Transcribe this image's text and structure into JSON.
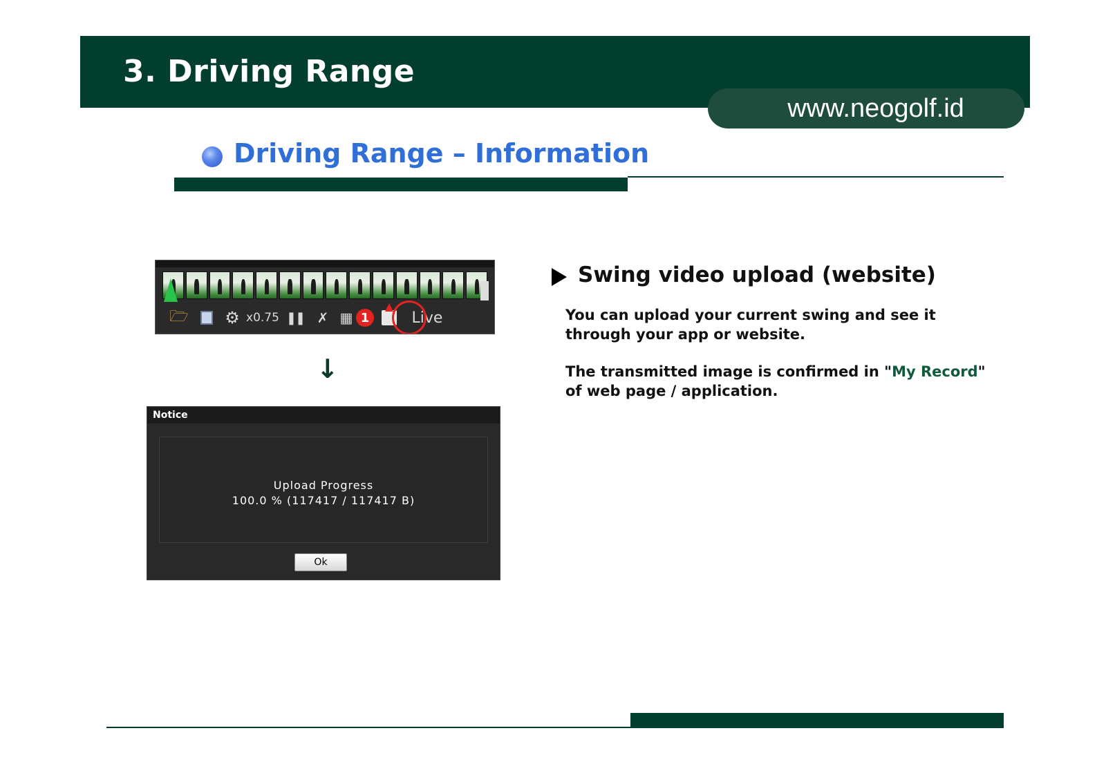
{
  "header": {
    "title": "3. Driving Range",
    "url": "www.neogolf.id"
  },
  "section": {
    "title": "Driving Range – Information"
  },
  "toolbar": {
    "speed_label": "x0.75",
    "live_label": "Live",
    "step_badge": "1",
    "icons": [
      "folder-icon",
      "save-icon",
      "gear-icon",
      "pause-icon",
      "club-icon",
      "grid-icon",
      "upload-icon"
    ]
  },
  "dialog": {
    "title": "Notice",
    "progress_label": "Upload Progress",
    "progress_value": "100.0 % (117417 / 117417 B)",
    "ok_label": "Ok"
  },
  "content": {
    "heading": "Swing video upload (website)",
    "para1": "You can upload your current swing and see it through your app or website.",
    "para2_before": "The transmitted image is confirmed in \"",
    "para2_highlight": "My Record",
    "para2_after": "\" of web page / application."
  },
  "colors": {
    "brand_dark_green": "#023e2e",
    "section_blue": "#2f6fd7",
    "highlight_green": "#0e5a3b",
    "marker_red": "#e3231f"
  }
}
